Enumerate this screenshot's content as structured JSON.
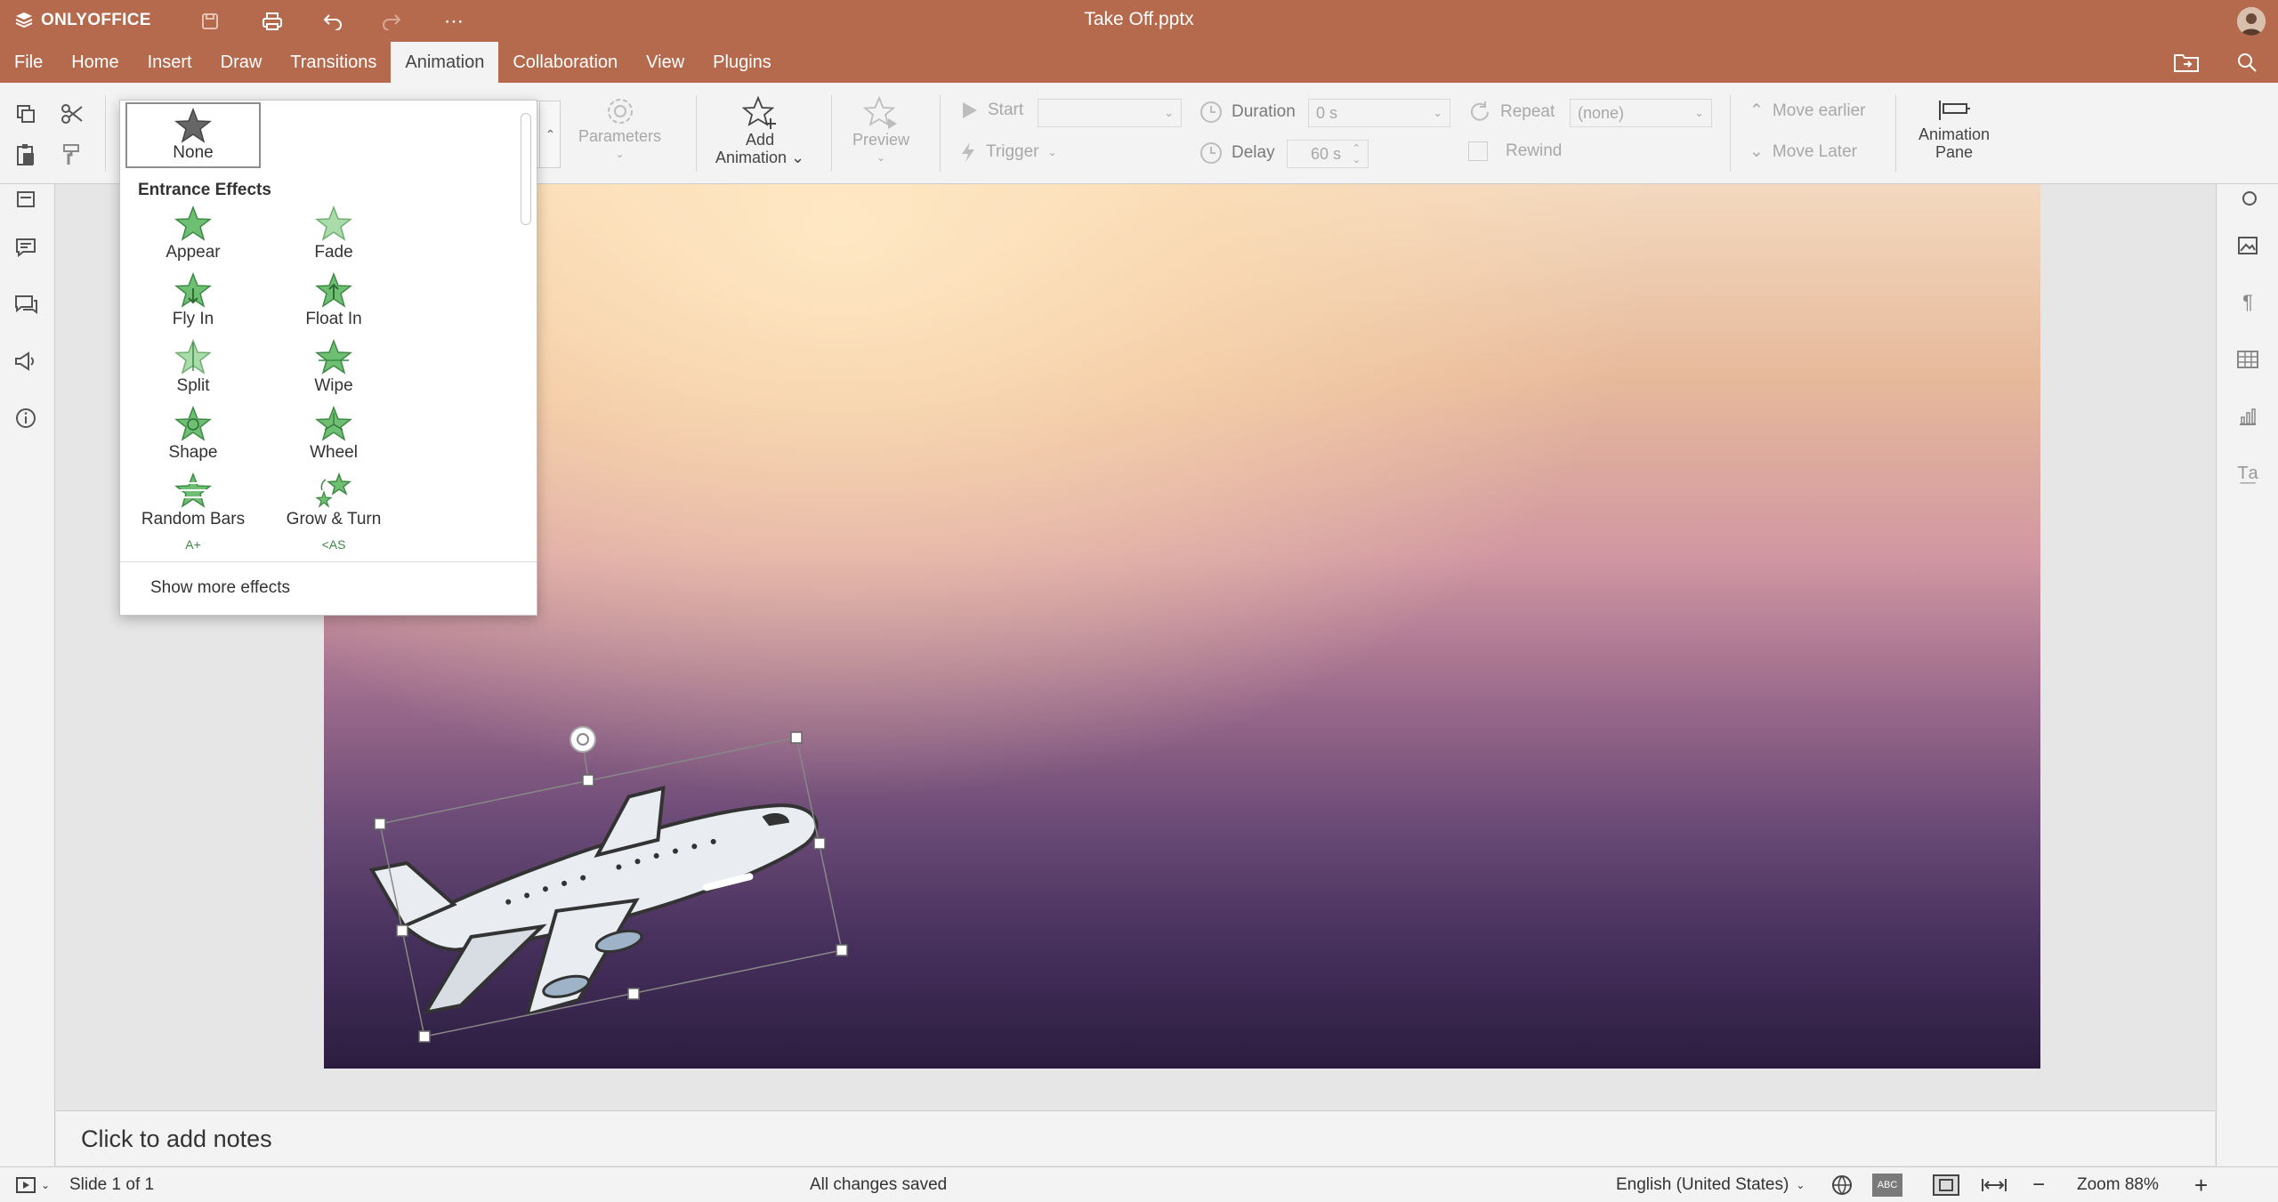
{
  "app": {
    "brand": "ONLYOFFICE",
    "document_title": "Take Off.pptx",
    "accent_color": "#b56a4e"
  },
  "menu": {
    "items": [
      {
        "label": "File"
      },
      {
        "label": "Home"
      },
      {
        "label": "Insert"
      },
      {
        "label": "Draw"
      },
      {
        "label": "Transitions"
      },
      {
        "label": "Animation",
        "active": true
      },
      {
        "label": "Collaboration"
      },
      {
        "label": "View"
      },
      {
        "label": "Plugins"
      }
    ]
  },
  "toolbar": {
    "parameters_label": "Parameters",
    "add_animation_label": "Add",
    "add_animation_label2": "Animation",
    "preview_label": "Preview",
    "start_label": "Start",
    "start_value": "",
    "trigger_label": "Trigger",
    "duration_label": "Duration",
    "duration_value": "0 s",
    "delay_label": "Delay",
    "delay_value": "60 s",
    "repeat_label": "Repeat",
    "repeat_value": "(none)",
    "rewind_label": "Rewind",
    "move_earlier_label": "Move earlier",
    "move_later_label": "Move Later",
    "animation_pane_label": "Animation",
    "animation_pane_label2": "Pane"
  },
  "animation_dropdown": {
    "none_label": "None",
    "section_heading": "Entrance Effects",
    "effects": [
      {
        "label": "Appear"
      },
      {
        "label": "Fade"
      },
      {
        "label": "Fly In"
      },
      {
        "label": "Float In"
      },
      {
        "label": "Split"
      },
      {
        "label": "Wipe"
      },
      {
        "label": "Shape"
      },
      {
        "label": "Wheel"
      },
      {
        "label": "Random Bars"
      },
      {
        "label": "Grow & Turn"
      }
    ],
    "show_more_label": "Show more effects"
  },
  "notes": {
    "placeholder": "Click to add notes"
  },
  "status_bar": {
    "slide_counter": "Slide 1 of 1",
    "save_status": "All changes saved",
    "language": "English (United States)",
    "zoom": "Zoom 88%"
  }
}
